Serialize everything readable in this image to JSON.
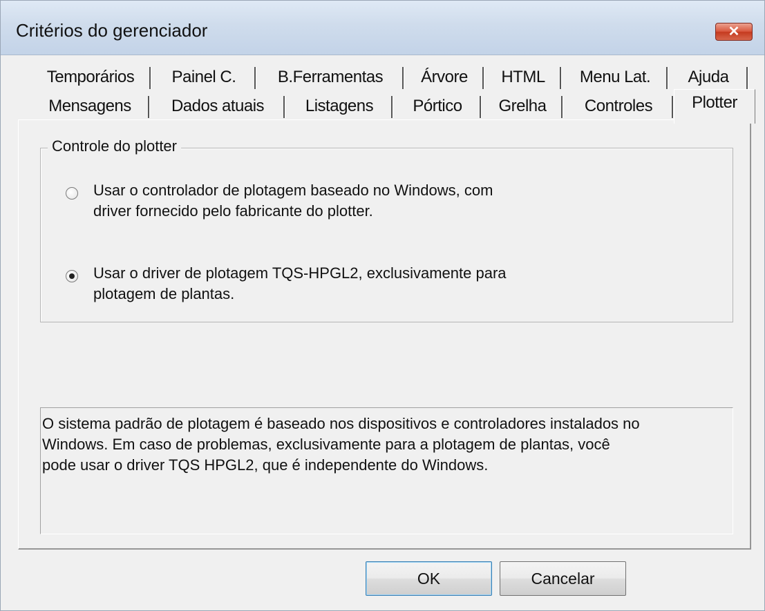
{
  "window": {
    "title": "Critérios do gerenciador",
    "close_glyph": "✕"
  },
  "tabs": {
    "row1": [
      "Temporários",
      "Painel C.",
      "B.Ferramentas",
      "Árvore",
      "HTML",
      "Menu Lat.",
      "Ajuda"
    ],
    "row2": [
      "Mensagens",
      "Dados atuais",
      "Listagens",
      "Pórtico",
      "Grelha",
      "Controles",
      "Plotter"
    ],
    "active": "Plotter"
  },
  "group": {
    "legend": "Controle do plotter",
    "options": [
      {
        "label_line1": "Usar o controlador de plotagem baseado no Windows, com",
        "label_line2": "driver fornecido pelo fabricante do plotter.",
        "selected": false
      },
      {
        "label_line1": "Usar o driver de plotagem TQS-HPGL2, exclusivamente para",
        "label_line2": "plotagem de plantas.",
        "selected": true
      }
    ]
  },
  "info": {
    "line1": "O sistema padrão de plotagem é baseado nos dispositivos e controladores instalados no",
    "line2": "Windows. Em caso de problemas, exclusivamente para a plotagem de plantas, você",
    "line3": "pode usar o driver TQS HPGL2, que é independente do Windows."
  },
  "buttons": {
    "ok": "OK",
    "cancel": "Cancelar"
  }
}
